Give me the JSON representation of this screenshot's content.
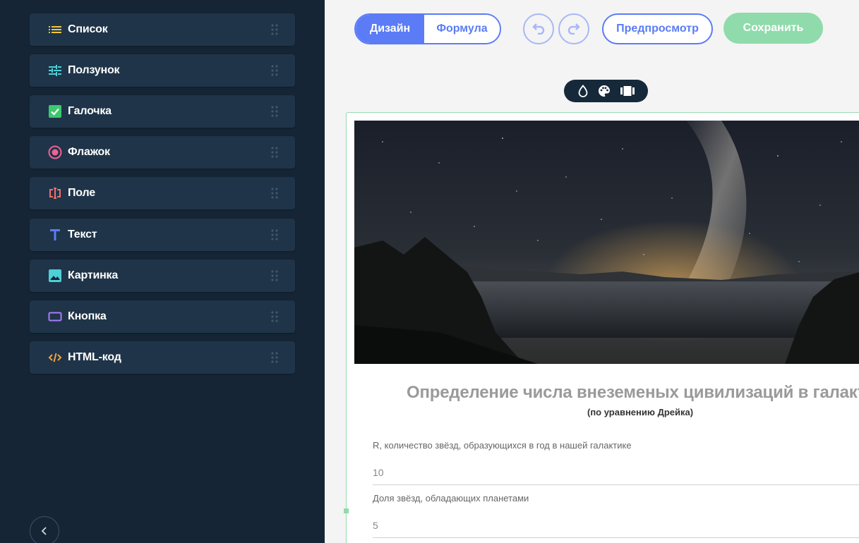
{
  "sidebar": {
    "items": [
      {
        "label": "Список",
        "icon": "list-icon",
        "color": "#f2c641"
      },
      {
        "label": "Ползунок",
        "icon": "sliders-icon",
        "color": "#4dd0d6"
      },
      {
        "label": "Галочка",
        "icon": "checkbox-icon",
        "color": "#3cc86e"
      },
      {
        "label": "Флажок",
        "icon": "radio-icon",
        "color": "#f06292"
      },
      {
        "label": "Поле",
        "icon": "text-field-icon",
        "color": "#ef6f6c"
      },
      {
        "label": "Текст",
        "icon": "text-icon",
        "color": "#5b7cf6"
      },
      {
        "label": "Картинка",
        "icon": "image-icon",
        "color": "#4dd0d6"
      },
      {
        "label": "Кнопка",
        "icon": "button-icon",
        "color": "#a77cf6"
      },
      {
        "label": "HTML-код",
        "icon": "code-icon",
        "color": "#f2a33a"
      }
    ]
  },
  "toolbar": {
    "tab_design": "Дизайн",
    "tab_formula": "Формула",
    "preview_label": "Предпросмотр",
    "save_label": "Сохранить"
  },
  "form": {
    "title": "Определение числа внеземеных цивилизаций в галакти",
    "subtitle": "(по уравнению Дрейка)",
    "fields": [
      {
        "label": "R, количество звёзд, образующихся в год в нашей галактике",
        "value": "10"
      },
      {
        "label": "Доля звёзд, обладающих планетами",
        "value": "5"
      }
    ]
  },
  "colors": {
    "accent": "#5b7cf6",
    "save": "#8fdbab",
    "sidebar_bg": "#152535",
    "sidebar_item_bg": "#1f3449"
  }
}
